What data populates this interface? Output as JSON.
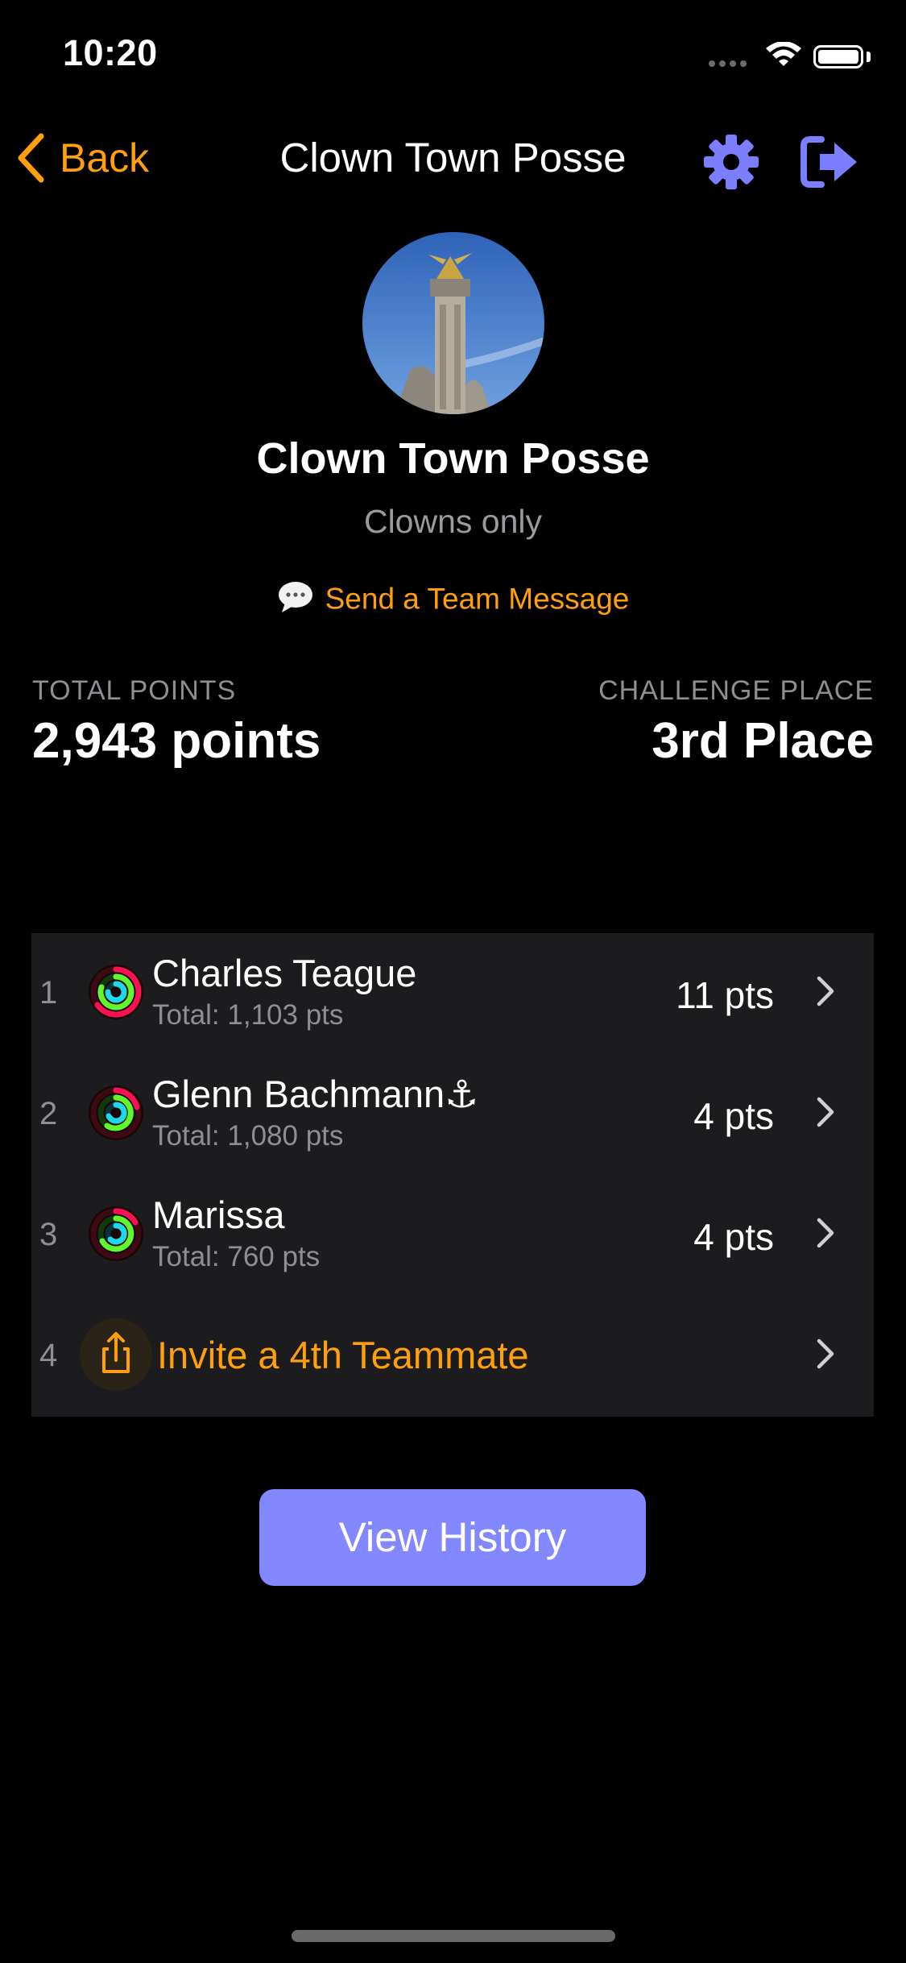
{
  "status_bar": {
    "time": "10:20"
  },
  "nav": {
    "back_label": "Back",
    "title": "Clown Town Posse"
  },
  "team": {
    "name": "Clown Town Posse",
    "description": "Clowns only",
    "send_message_label": "Send a Team Message"
  },
  "stats": {
    "total_points_label": "TOTAL POINTS",
    "total_points_value": "2,943 points",
    "challenge_place_label": "CHALLENGE PLACE",
    "challenge_place_value": "3rd Place"
  },
  "members": [
    {
      "rank": "1",
      "name": "Charles Teague",
      "total": "Total: 1,103 pts",
      "points": "11 pts"
    },
    {
      "rank": "2",
      "name": "Glenn Bachmann⚓",
      "total": "Total: 1,080 pts",
      "points": "4 pts"
    },
    {
      "rank": "3",
      "name": "Marissa",
      "total": "Total: 760 pts",
      "points": "4 pts"
    }
  ],
  "invite": {
    "rank": "4",
    "label": "Invite a 4th Teammate"
  },
  "view_history_label": "View History",
  "colors": {
    "accent": "#ff9f0a",
    "primary": "#8288ff",
    "background": "#000000",
    "list_bg": "#1c1c1e"
  },
  "icons": [
    "chevron-left-icon",
    "gear-icon",
    "logout-icon",
    "chat-bubble-icon",
    "activity-ring-icon",
    "share-icon",
    "chevron-right-icon"
  ]
}
